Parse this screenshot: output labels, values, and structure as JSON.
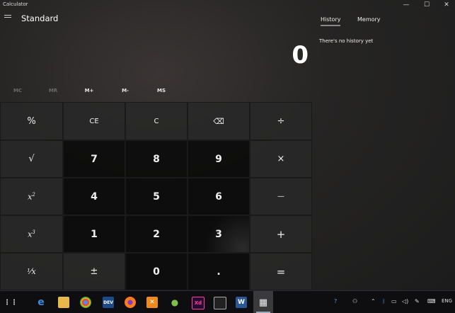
{
  "window": {
    "title": "Calculator",
    "minimize": "—",
    "maximize": "☐",
    "close": "✕"
  },
  "header": {
    "mode": "Standard"
  },
  "display": {
    "value": "0"
  },
  "memory": {
    "mc": "MC",
    "mr": "MR",
    "mplus": "M+",
    "mminus": "M-",
    "ms": "MS"
  },
  "keys": {
    "percent": "%",
    "ce": "CE",
    "c": "C",
    "backspace": "⌫",
    "divide": "÷",
    "sqrt": "√",
    "seven": "7",
    "eight": "8",
    "nine": "9",
    "multiply": "×",
    "square_base": "x",
    "square_exp": "2",
    "four": "4",
    "five": "5",
    "six": "6",
    "minus": "—",
    "cube_base": "x",
    "cube_exp": "3",
    "one": "1",
    "two": "2",
    "three": "3",
    "plus": "+",
    "reciprocal": "¹⁄x",
    "negate": "±",
    "zero": "0",
    "decimal": ".",
    "equals": "="
  },
  "side_panel": {
    "tab_history": "History",
    "tab_memory": "Memory",
    "empty_message": "There's no history yet"
  },
  "taskbar": {
    "language": "ENG"
  },
  "colors": {
    "accent": "#9aabbb",
    "background": "#1f1f1f"
  }
}
